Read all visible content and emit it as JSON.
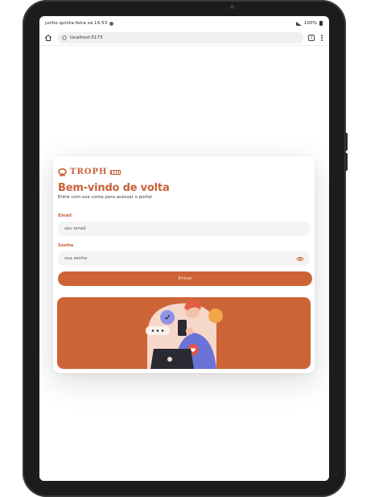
{
  "status_bar": {
    "left_text": "junho quinta-feira sá 14:53",
    "right_text": "100%"
  },
  "browser": {
    "url": "localhost:5173",
    "tabs_count": "1"
  },
  "login": {
    "brand": "TROPH",
    "title": "Bem-vindo de volta",
    "subtitle": "Entre com sua conta para acessar o portal",
    "email_label": "Email",
    "email_placeholder": "seu email",
    "password_label": "Senha",
    "password_placeholder": "sua senha",
    "submit_label": "Entrar"
  },
  "colors": {
    "accent": "#cd6438",
    "hero_bg": "#cd6438"
  },
  "icons": {
    "home": "home-icon",
    "tabs": "tabs-icon",
    "menu": "menu-icon",
    "password_toggle": "eye-icon",
    "brand": "brand-logo-icon"
  }
}
